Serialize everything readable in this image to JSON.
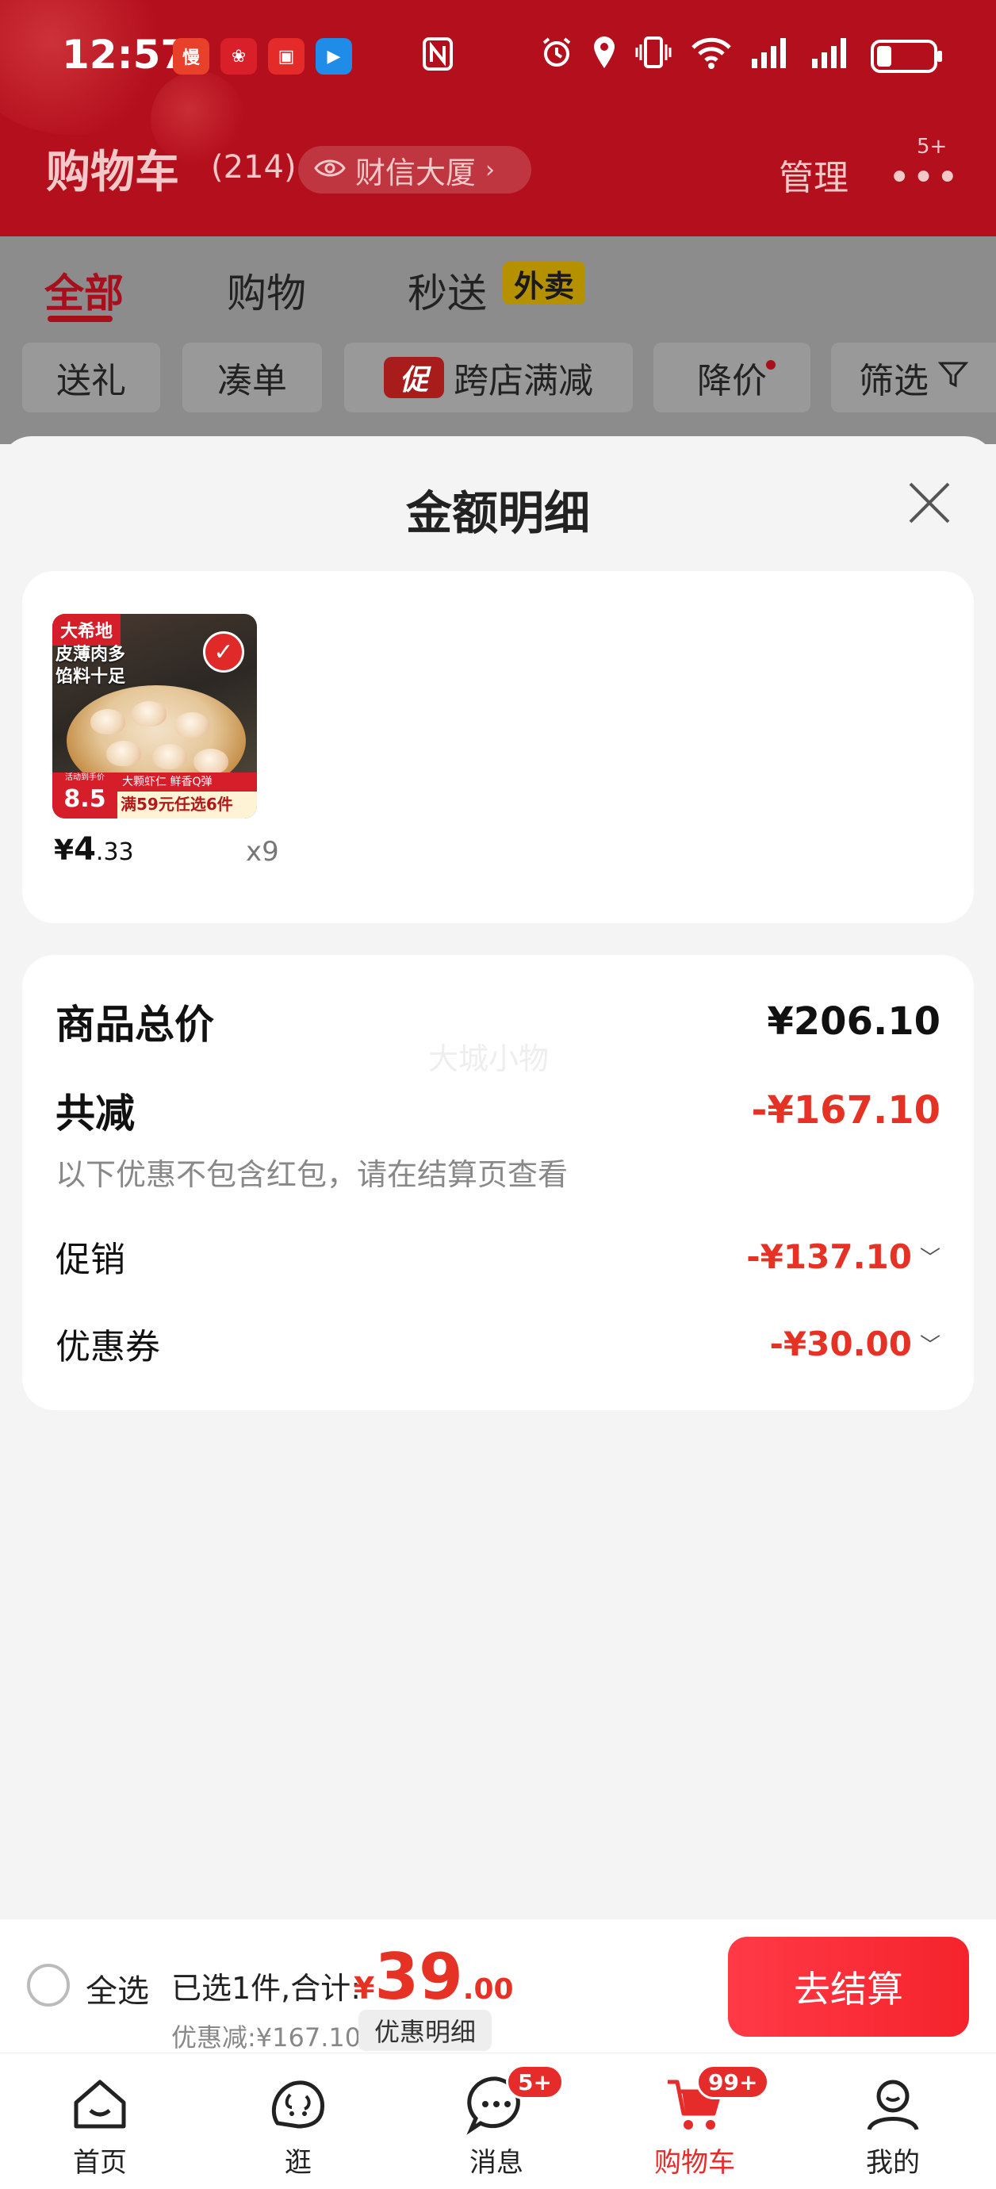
{
  "status_bar": {
    "time": "12:57",
    "app_icons": [
      {
        "name": "manbo-app-icon",
        "glyph": "慢",
        "color": "#e8402a"
      },
      {
        "name": "jd-618-app-icon",
        "glyph": "❀",
        "color": "#d9202a"
      },
      {
        "name": "red-book-app-icon",
        "glyph": "▣",
        "color": "#e52a2a"
      },
      {
        "name": "blue-send-app-icon",
        "glyph": "▶",
        "color": "#1f8de8"
      }
    ]
  },
  "header": {
    "title": "购物车",
    "count": "(214)",
    "location": "财信大厦",
    "manage": "管理",
    "more_badge": "5+"
  },
  "tabs": [
    {
      "label": "全部",
      "active": true
    },
    {
      "label": "购物",
      "active": false
    },
    {
      "label": "秒送",
      "active": false
    }
  ],
  "waimai_tag": "外卖",
  "chips": [
    {
      "label": "送礼"
    },
    {
      "label": "凑单"
    },
    {
      "label": "跨店满减",
      "tag": "促"
    },
    {
      "label": "降价"
    },
    {
      "label": "筛选"
    }
  ],
  "sheet": {
    "title": "金额明细",
    "item": {
      "brand": "大希地",
      "slogan_1": "皮薄肉多",
      "slogan_2": "馅料十足",
      "thumb_price_caption": "活动到手价",
      "thumb_price": "8.5",
      "thumb_strip_top": "大颗虾仁  鲜香Q弹",
      "thumb_strip_bottom": "满59元任选6件",
      "price_yen": "¥",
      "price_int": "4",
      "price_dec": ".33",
      "qty": "x9"
    },
    "summary": {
      "watermark": "大城小物",
      "total_label": "商品总价",
      "total_value": "¥206.10",
      "reduce_label": "共减",
      "reduce_value": "-¥167.10",
      "note": "以下优惠不包含红包，请在结算页查看",
      "promo_label": "促销",
      "promo_value": "-¥137.10",
      "coupon_label": "优惠券",
      "coupon_value": "-¥30.00"
    }
  },
  "checkout": {
    "select_all": "全选",
    "selected": "已选1件,合计:",
    "yen": "¥",
    "total_int": "39",
    "total_dec": ".00",
    "discount": "优惠减:¥167.10",
    "detail_btn": "优惠明细",
    "checkout_btn": "去结算"
  },
  "nav": [
    {
      "label": "首页",
      "icon": "home-icon"
    },
    {
      "label": "逛",
      "icon": "browse-icon"
    },
    {
      "label": "消息",
      "icon": "message-icon",
      "badge": "5+"
    },
    {
      "label": "购物车",
      "icon": "cart-icon",
      "badge": "99+",
      "active": true
    },
    {
      "label": "我的",
      "icon": "profile-icon"
    }
  ],
  "colors": {
    "brand_red": "#e63224",
    "header_red": "#b30f1c",
    "checkout_red": "#f5232c"
  }
}
